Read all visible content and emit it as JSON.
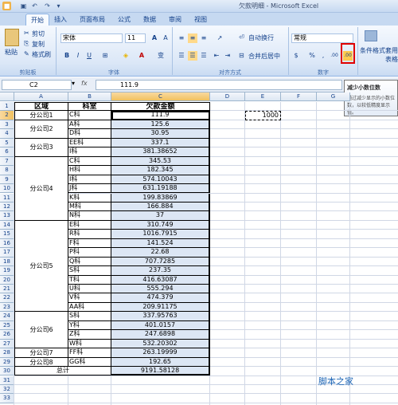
{
  "window": {
    "title": "欠款明细 - Microsoft Excel"
  },
  "tabs": [
    "开始",
    "插入",
    "页面布局",
    "公式",
    "数据",
    "审阅",
    "视图"
  ],
  "ribbon": {
    "clipboard": {
      "paste": "粘贴",
      "cut": "剪切",
      "copy": "复制",
      "format_painter": "格式刷",
      "label": "剪贴板"
    },
    "font": {
      "name": "宋体",
      "size": "11",
      "label": "字体",
      "bold": "B",
      "italic": "I",
      "underline": "U",
      "grow": "A",
      "shrink": "A",
      "wen": "变"
    },
    "alignment": {
      "wrap": "自动换行",
      "merge": "合并后居中",
      "label": "对齐方式"
    },
    "number": {
      "format": "常规",
      "label": "数字",
      "percent": "%",
      "comma": ",",
      "inc": ".00",
      "dec": ".00"
    },
    "styles": {
      "cond": "条件格式",
      "table": "套用表格"
    }
  },
  "formula_bar": {
    "name_box": "C2",
    "fx": "fx",
    "value": "111.9"
  },
  "tooltip": {
    "title": "减少小数位数",
    "body": "通过减少显示的小数位数，以较低精度显示值。"
  },
  "grid": {
    "columns": [
      "A",
      "B",
      "C",
      "D",
      "E",
      "F",
      "G"
    ],
    "rows": [
      "1",
      "2",
      "3",
      "4",
      "5",
      "6",
      "7",
      "8",
      "9",
      "10",
      "11",
      "12",
      "13",
      "14",
      "15",
      "16",
      "17",
      "18",
      "19",
      "20",
      "21",
      "22",
      "23",
      "24",
      "25",
      "26",
      "27",
      "28",
      "29",
      "30",
      "31",
      "32",
      "33"
    ],
    "headers": {
      "a": "区域",
      "b": "科室",
      "c": "欠款金额"
    },
    "groups": [
      "分公司1",
      "分公司2",
      "分公司3",
      "分公司4",
      "分公司5",
      "分公司6",
      "分公司7",
      "分公司8"
    ],
    "depts": [
      "C科",
      "A科",
      "D科",
      "EE科",
      "I科",
      "C科",
      "H科",
      "I科",
      "J科",
      "K科",
      "M科",
      "N科",
      "E科",
      "R科",
      "F科",
      "P科",
      "Q科",
      "S科",
      "T科",
      "U科",
      "V科",
      "AA科",
      "S科",
      "Y科",
      "Z科",
      "W科",
      "FF科",
      "GG科"
    ],
    "amounts": [
      "111.9",
      "125.6",
      "30.95",
      "337.1",
      "381.38652",
      "345.53",
      "182.345",
      "574.10043",
      "631.19188",
      "199.83869",
      "166.884",
      "37",
      "310.749",
      "1016.7915",
      "141.524",
      "22.68",
      "707.7285",
      "237.35",
      "416.63087",
      "555.294",
      "474.379",
      "209.91175",
      "337.95763",
      "401.0157",
      "247.6898",
      "532.20302",
      "263.19999",
      "192.65"
    ],
    "total_label": "总计",
    "total_value": "9191.58128",
    "e2": "1000"
  },
  "watermark": "脚本之家"
}
